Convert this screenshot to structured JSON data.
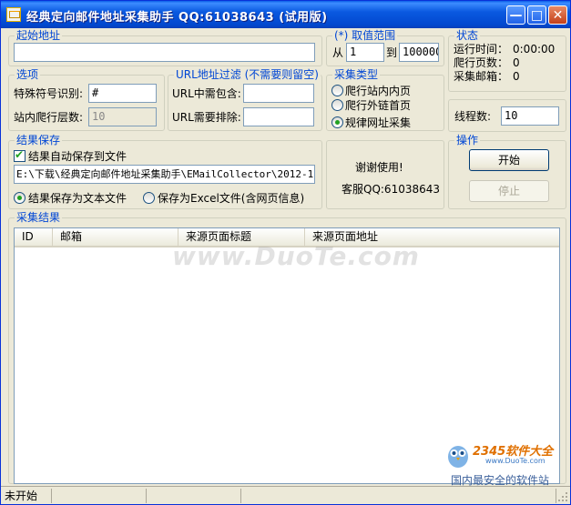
{
  "window": {
    "title": "经典定向邮件地址采集助手 QQ:61038643 (试用版)",
    "minimize_glyph": "—",
    "maximize_glyph": "□",
    "close_glyph": "✕"
  },
  "start_address": {
    "label": "起始地址",
    "value": ""
  },
  "range": {
    "label": "(*) 取值范围",
    "from_label": "从",
    "from_value": "1",
    "to_label": "到",
    "to_value": "100000"
  },
  "status": {
    "label": "状态",
    "run_time_label": "运行时间：",
    "run_time_value": "0:00:00",
    "pages_label": "爬行页数：",
    "pages_value": "0",
    "emails_label": "采集邮箱：",
    "emails_value": "0"
  },
  "options": {
    "label": "选项",
    "special_char_label": "特殊符号识别:",
    "special_char_value": "#",
    "depth_label": "站内爬行层数:",
    "depth_value": "10"
  },
  "url_filter": {
    "label": "URL地址过滤 (不需要则留空)",
    "include_label": "URL中需包含:",
    "include_value": "",
    "exclude_label": "URL需要排除:",
    "exclude_value": ""
  },
  "collect_type": {
    "label": "采集类型",
    "options": [
      "爬行站内内页",
      "爬行外链首页",
      "规律网址采集"
    ],
    "selected": 2
  },
  "threads": {
    "label": "线程数:",
    "value": "10"
  },
  "save": {
    "label": "结果保存",
    "auto_save_label": "结果自动保存到文件",
    "path": "E:\\下载\\经典定向邮件地址采集助手\\EMailCollector\\2012-1",
    "as_text_label": "结果保存为文本文件",
    "as_excel_label": "保存为Excel文件(含网页信息)"
  },
  "thanks": {
    "line1": "谢谢使用!",
    "line2": "客服QQ:61038643"
  },
  "operation": {
    "label": "操作",
    "start": "开始",
    "stop": "停止"
  },
  "results": {
    "label": "采集结果",
    "columns": [
      "ID",
      "邮箱",
      "来源页面标题",
      "来源页面地址"
    ],
    "rows": []
  },
  "statusbar": {
    "text": "未开始"
  },
  "watermark": {
    "text": "www.DuoTe.com"
  },
  "brand": {
    "logo_text": "2345软件大全",
    "url": "www.DuoTe.com",
    "slogan": "国内最安全的软件站"
  }
}
